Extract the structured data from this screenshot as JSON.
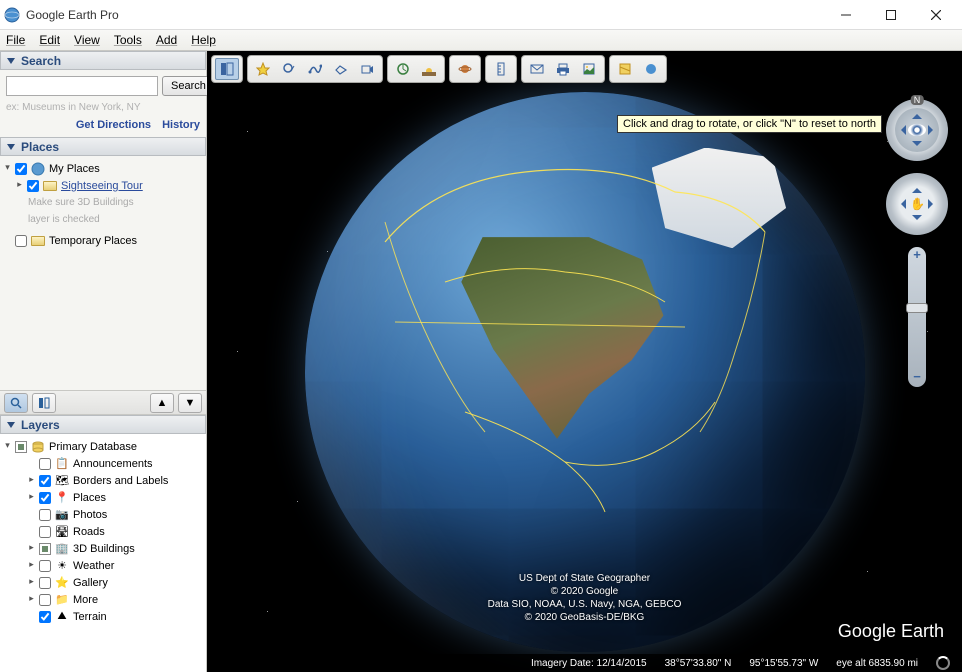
{
  "window": {
    "title": "Google Earth Pro"
  },
  "menubar": [
    "File",
    "Edit",
    "View",
    "Tools",
    "Add",
    "Help"
  ],
  "search": {
    "header": "Search",
    "placeholder": "",
    "button": "Search",
    "hint": "ex: Museums in New York, NY",
    "link_directions": "Get Directions",
    "link_history": "History"
  },
  "places": {
    "header": "Places",
    "my_places": "My Places",
    "tour": "Sightseeing Tour",
    "tour_note1": "Make sure 3D Buildings",
    "tour_note2": "layer is checked",
    "temp": "Temporary Places"
  },
  "layers": {
    "header": "Layers",
    "primary_db": "Primary Database",
    "items": [
      {
        "label": "Announcements",
        "checked": false,
        "expandable": false
      },
      {
        "label": "Borders and Labels",
        "checked": true,
        "expandable": true
      },
      {
        "label": "Places",
        "checked": true,
        "expandable": true
      },
      {
        "label": "Photos",
        "checked": false,
        "expandable": false
      },
      {
        "label": "Roads",
        "checked": false,
        "expandable": false
      },
      {
        "label": "3D Buildings",
        "checked": "partial",
        "expandable": true
      },
      {
        "label": "Weather",
        "checked": false,
        "expandable": true
      },
      {
        "label": "Gallery",
        "checked": false,
        "expandable": true
      },
      {
        "label": "More",
        "checked": false,
        "expandable": true
      },
      {
        "label": "Terrain",
        "checked": true,
        "expandable": false
      }
    ]
  },
  "tooltip": "Click and drag to rotate, or click \"N\" to reset to north",
  "attribution": {
    "l1": "US Dept of State Geographer",
    "l2": "© 2020 Google",
    "l3": "Data SIO, NOAA, U.S. Navy, NGA, GEBCO",
    "l4": "© 2020 GeoBasis-DE/BKG"
  },
  "logo": "Google Earth",
  "status": {
    "imagery": "Imagery Date: 12/14/2015",
    "lat": "38°57'33.80\" N",
    "lon": "95°15'55.73\" W",
    "alt": "eye alt 6835.90 mi"
  },
  "compass_n": "N"
}
